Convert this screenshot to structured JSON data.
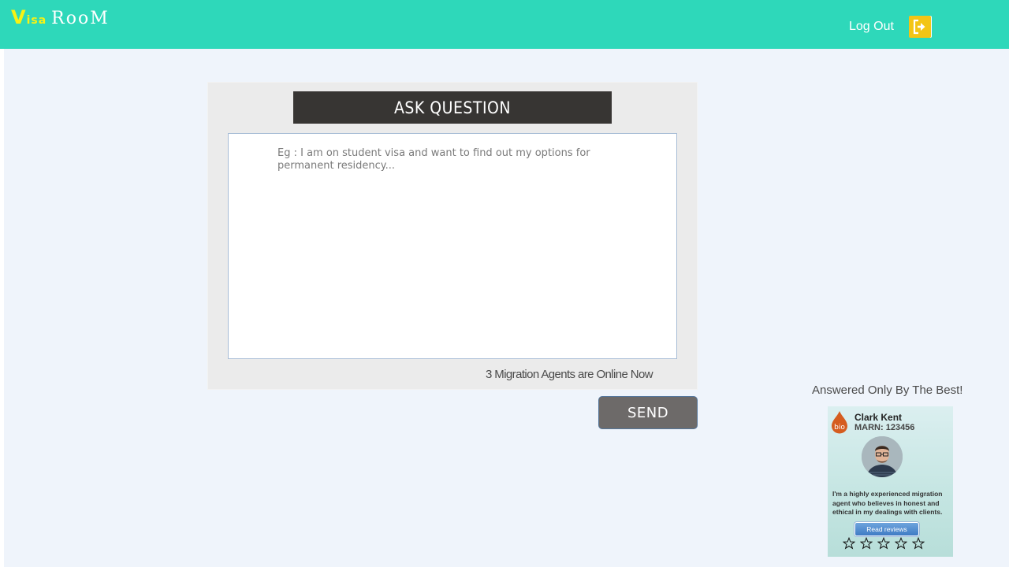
{
  "header": {
    "logo": {
      "v": "V",
      "isa": "isa",
      "room": "RooM"
    },
    "logout_label": "Log Out",
    "logout_icon": "sign-out-icon",
    "background_color": "#2ed8ba",
    "accent_color": "#f3c515"
  },
  "ask": {
    "title": "ASK QUESTION",
    "placeholder": "Eg : I am on student visa and want to find out my options for permanent residency...",
    "value": "",
    "agents_online": "3 Migration Agents are Online Now",
    "send_label": "SEND"
  },
  "sidebar": {
    "answered_label": "Answered Only By The Best!",
    "agent": {
      "badge": "bio",
      "name": "Clark Kent",
      "marn": "MARN: 123456",
      "bio": "I'm a highly experienced migration agent who believes in honest and ethical in my dealings with clients.",
      "read_reviews_label": "Read reviews",
      "rating": 0,
      "rating_max": 5
    }
  }
}
